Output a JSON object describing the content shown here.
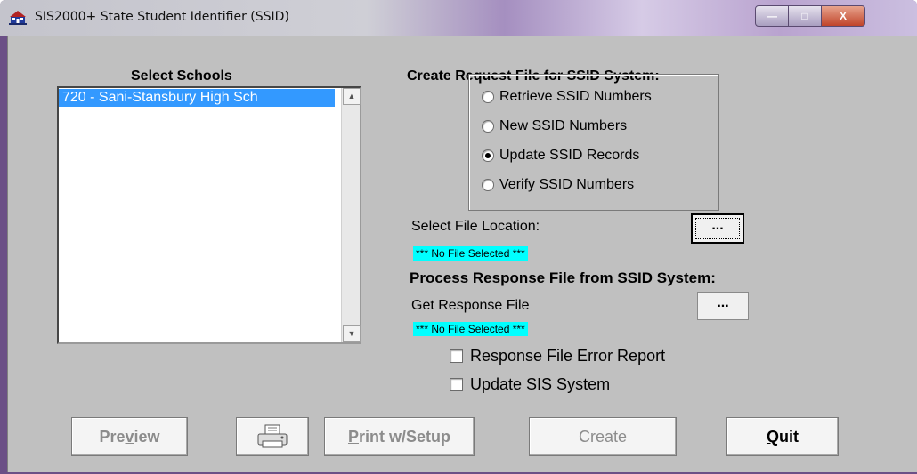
{
  "window": {
    "title": "SIS2000+ State Student Identifier (SSID)",
    "minimize": "—",
    "maximize": "□",
    "close": "X"
  },
  "schools": {
    "label": "Select Schools",
    "items": [
      "720 - Sani-Stansbury High Sch"
    ]
  },
  "request": {
    "heading": "Create Request File for SSID System:",
    "options": [
      {
        "label": "Retrieve SSID Numbers",
        "selected": false
      },
      {
        "label": "New SSID Numbers",
        "selected": false
      },
      {
        "label": "Update SSID Records",
        "selected": true
      },
      {
        "label": "Verify SSID Numbers",
        "selected": false
      }
    ],
    "file_location_label": "Select File Location:",
    "browse_label": "...",
    "no_file": "*** No File Selected ***"
  },
  "response": {
    "heading": "Process Response File from SSID System:",
    "get_label": "Get Response File",
    "browse_label": "...",
    "no_file": "*** No File Selected ***",
    "error_report_label": "Response File Error Report",
    "update_sis_label": "Update SIS System"
  },
  "buttons": {
    "preview_pre": "Pre",
    "preview_u": "v",
    "preview_post": "iew",
    "print_u": "P",
    "print_post": "rint w/Setup",
    "create": "Create",
    "quit_u": "Q",
    "quit_post": "uit"
  },
  "icons": {
    "app": "school-building-icon",
    "printer": "printer-icon"
  }
}
